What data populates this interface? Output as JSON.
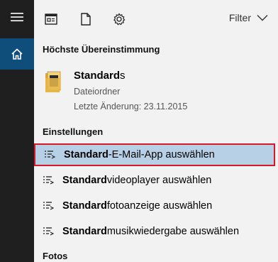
{
  "topbar": {
    "filter_label": "Filter"
  },
  "best_match": {
    "header": "Höchste Übereinstimmung",
    "title_bold": "Standard",
    "title_rest": "s",
    "type": "Dateiordner",
    "modified": "Letzte Änderung: 23.11.2015"
  },
  "settings": {
    "header": "Einstellungen",
    "items": [
      {
        "bold": "Standard",
        "rest": "-E-Mail-App auswählen",
        "selected": true
      },
      {
        "bold": "Standard",
        "rest": "videoplayer auswählen",
        "selected": false
      },
      {
        "bold": "Standard",
        "rest": "fotoanzeige auswählen",
        "selected": false
      },
      {
        "bold": "Standard",
        "rest": "musikwiedergabe auswählen",
        "selected": false
      }
    ]
  },
  "photos": {
    "header": "Fotos"
  },
  "icons": {
    "hamburger": "hamburger-icon",
    "home": "home-icon",
    "apps": "apps-icon",
    "document": "document-icon",
    "settings": "gear-icon",
    "filter": "chevron-down-icon",
    "folder": "folder-icon",
    "setting_item": "settings-list-icon"
  },
  "colors": {
    "sidebar": "#1f1f1f",
    "home_active": "#0f4d7a",
    "selected_bg": "#b8d0e6",
    "selected_border": "#d7182a"
  }
}
